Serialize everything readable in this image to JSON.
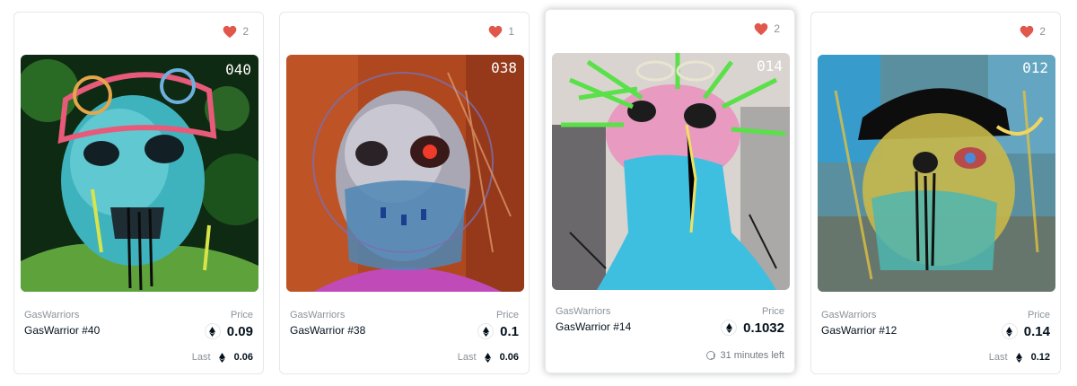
{
  "colors": {
    "heart": "#e2574c",
    "text": "#04111d",
    "muted": "#8a939b"
  },
  "cards": [
    {
      "favorites": "2",
      "art_number": "040",
      "collection": "GasWarriors",
      "name": "GasWarrior #40",
      "price_label": "Price",
      "price": "0.09",
      "last_label": "Last",
      "last_price": "0.06"
    },
    {
      "favorites": "1",
      "art_number": "038",
      "collection": "GasWarriors",
      "name": "GasWarrior #38",
      "price_label": "Price",
      "price": "0.1",
      "last_label": "Last",
      "last_price": "0.06"
    },
    {
      "favorites": "2",
      "art_number": "014",
      "collection": "GasWarriors",
      "name": "GasWarrior #14",
      "price_label": "Price",
      "price": "0.1032",
      "time_left": "31 minutes left"
    },
    {
      "favorites": "2",
      "art_number": "012",
      "collection": "GasWarriors",
      "name": "GasWarrior #12",
      "price_label": "Price",
      "price": "0.14",
      "last_label": "Last",
      "last_price": "0.12"
    }
  ]
}
